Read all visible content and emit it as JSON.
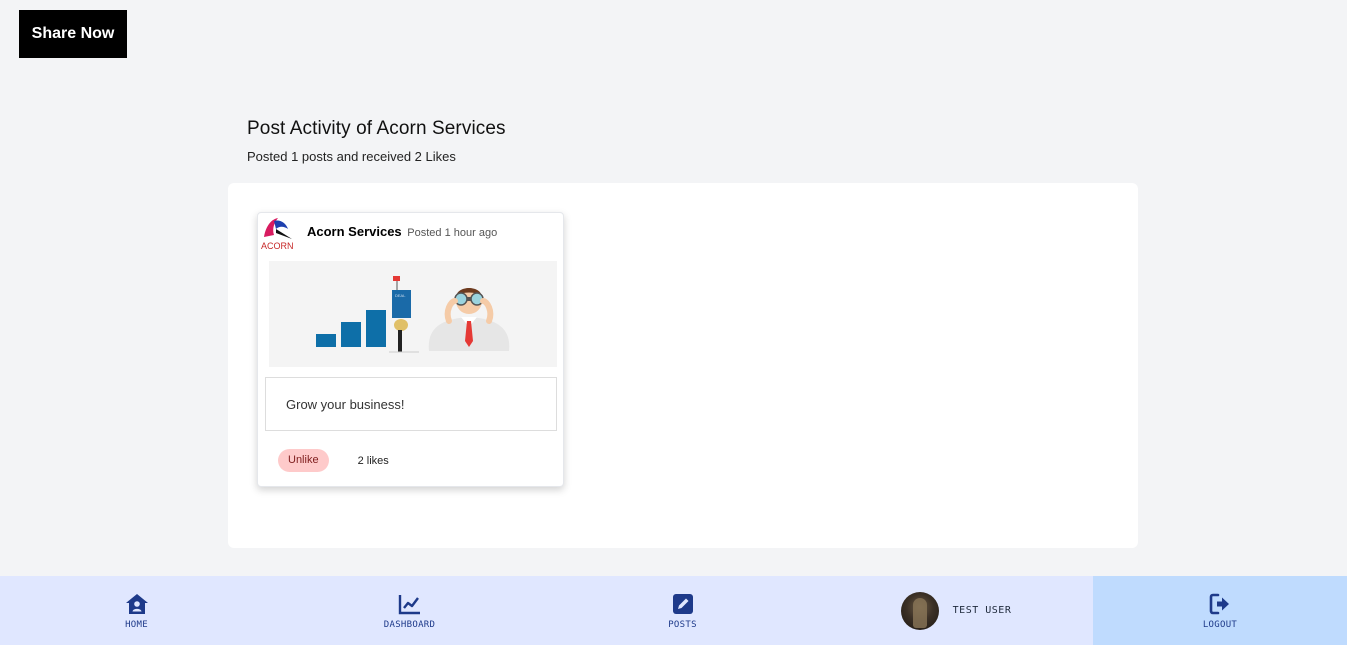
{
  "brand": {
    "label": "Share Now"
  },
  "activity": {
    "title": "Post Activity of Acorn Services",
    "summary": "Posted 1 posts and received 2 Likes"
  },
  "post": {
    "author": "Acorn Services",
    "posted": "Posted 1 hour ago",
    "logo_text": "ACORN",
    "caption": "Grow your business!",
    "unlike_label": "Unlike",
    "likes": "2 likes",
    "image_flag_text": "DEAL"
  },
  "nav": {
    "home": "HOME",
    "dashboard": "DASHBOARD",
    "posts": "POSTS",
    "user": "TEST USER",
    "logout": "LOGOUT"
  },
  "colors": {
    "nav_bg": "#e0e7ff",
    "logout_bg": "#bfdbfe",
    "icon": "#1e3a8a",
    "unlike_bg": "#fecaca"
  }
}
